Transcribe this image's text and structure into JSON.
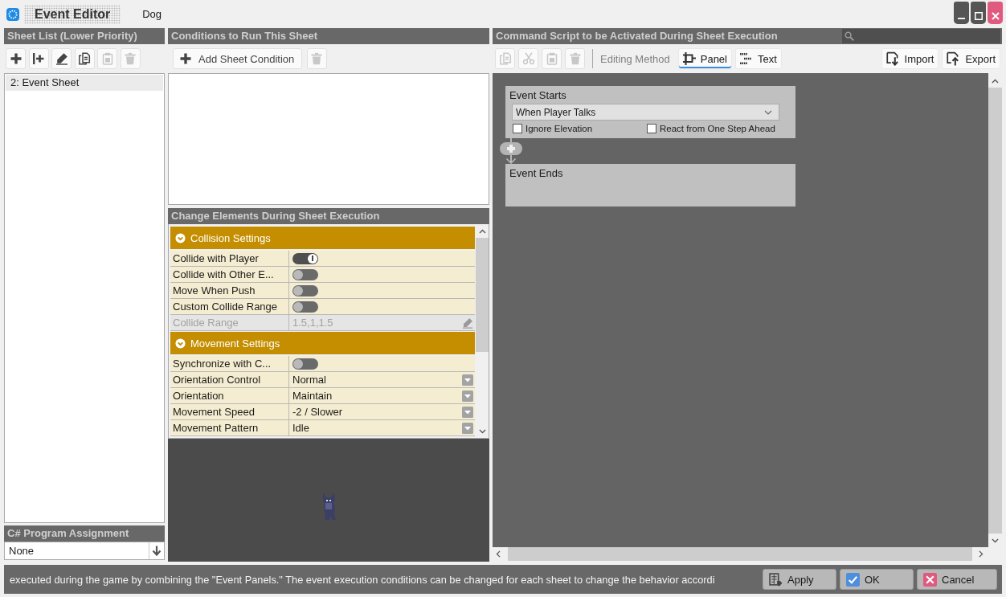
{
  "window": {
    "title": "Event Editor",
    "subtitle": "Dog"
  },
  "sheet_list": {
    "header": "Sheet List (Lower Priority)",
    "tools": [
      {
        "kind": "add",
        "disabled": false
      },
      {
        "kind": "insert",
        "disabled": false
      },
      {
        "kind": "rename",
        "disabled": false
      },
      {
        "kind": "copy",
        "disabled": false
      },
      {
        "kind": "paste",
        "disabled": true
      },
      {
        "kind": "delete",
        "disabled": true
      }
    ],
    "items": [
      {
        "label": "2: Event Sheet",
        "selected": true
      }
    ]
  },
  "program_assignment": {
    "header": "C# Program Assignment",
    "value": "None"
  },
  "conditions": {
    "header": "Conditions to Run This Sheet",
    "add_button": {
      "label": "Add Sheet Condition",
      "disabled": false
    },
    "delete_button": {
      "disabled": true
    }
  },
  "properties": {
    "header": "Change Elements During Sheet Execution",
    "groups": [
      {
        "title": "Collision Settings",
        "expanded": true,
        "rows": [
          {
            "label": "Collide with Player",
            "kind": "toggle",
            "on": true,
            "disabled": false
          },
          {
            "label": "Collide with Other E...",
            "kind": "toggle",
            "on": false,
            "disabled": false
          },
          {
            "label": "Move When Push",
            "kind": "toggle",
            "on": false,
            "disabled": false
          },
          {
            "label": "Custom Collide Range",
            "kind": "toggle",
            "on": false,
            "disabled": false
          },
          {
            "label": "Collide Range",
            "kind": "text",
            "value": "1.5,1,1.5",
            "disabled": true
          }
        ]
      },
      {
        "title": "Movement Settings",
        "expanded": true,
        "rows": [
          {
            "label": "Synchronize with C...",
            "kind": "toggle",
            "on": false,
            "disabled": false
          },
          {
            "label": "Orientation Control",
            "kind": "dropdown",
            "value": "Normal",
            "disabled": false
          },
          {
            "label": "Orientation",
            "kind": "dropdown",
            "value": "Maintain",
            "disabled": false
          },
          {
            "label": "Movement Speed",
            "kind": "dropdown",
            "value": "-2 / Slower",
            "disabled": false
          },
          {
            "label": "Movement Pattern",
            "kind": "dropdown",
            "value": "Idle",
            "disabled": false
          }
        ]
      }
    ]
  },
  "command_script": {
    "header": "Command Script to be Activated During Sheet Execution",
    "tools": [
      {
        "kind": "copy",
        "disabled": true
      },
      {
        "kind": "cut",
        "disabled": true
      },
      {
        "kind": "paste",
        "disabled": true
      },
      {
        "kind": "delete",
        "disabled": true
      }
    ],
    "editing_method": "Editing Method",
    "tabs": [
      {
        "label": "Panel",
        "kind": "panel",
        "selected": true
      },
      {
        "label": "Text",
        "kind": "text",
        "selected": false
      }
    ],
    "actions": [
      {
        "label": "Import",
        "kind": "import"
      },
      {
        "label": "Export",
        "kind": "export"
      }
    ],
    "panels": [
      {
        "kind": "start",
        "title": "Event Starts",
        "trigger": "When Player Talks",
        "options": [
          {
            "label": "Ignore Elevation",
            "checked": false
          },
          {
            "label": "React from One Step Ahead",
            "checked": false
          }
        ]
      },
      {
        "kind": "end",
        "title": "Event Ends"
      }
    ]
  },
  "status_bar": {
    "message": "executed during the game by combining the \"Event Panels.\"  The event execution conditions can be changed for each sheet to change the behavior accordi",
    "buttons": [
      {
        "label": "Apply",
        "kind": "apply"
      },
      {
        "label": "OK",
        "kind": "ok"
      },
      {
        "label": "Cancel",
        "kind": "cancel"
      }
    ]
  }
}
